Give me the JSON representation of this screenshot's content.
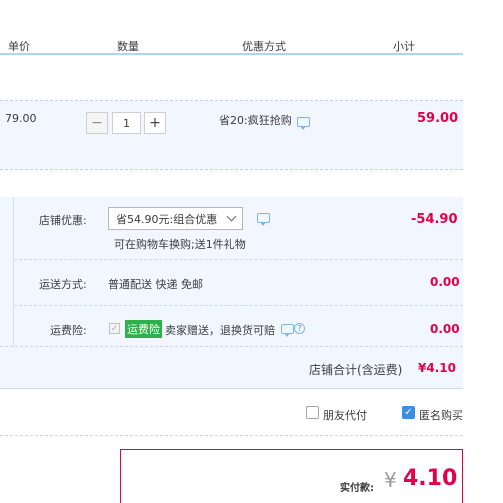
{
  "header": {
    "unit_price": "单价",
    "quantity": "数量",
    "discount_method": "优惠方式",
    "subtotal": "小计"
  },
  "item": {
    "unit_price": "79.00",
    "quantity": "1",
    "minus": "−",
    "plus": "+",
    "discount": "省20:疯狂抢购",
    "subtotal": "59.00"
  },
  "order": {
    "shop_discount_label": "店铺优惠:",
    "shop_discount_selected": "省54.90元:组合优惠",
    "shop_discount_note": "可在购物车换购;送1件礼物",
    "shop_discount_amount": "-54.90",
    "shipping_label": "运送方式:",
    "shipping_value": "普通配送 快递 免邮",
    "shipping_amount": "0.00",
    "insurance_label": "运费险:",
    "insurance_badge": "运费险",
    "insurance_text": "卖家赠送，退换货可赔",
    "insurance_amount": "0.00",
    "shop_total_label": "店铺合计(含运费)",
    "shop_total_amount": "¥4.10"
  },
  "options": {
    "friend_pay": "朋友代付",
    "anonymous_buy": "匿名购买"
  },
  "payment": {
    "label": "实付款:",
    "currency": "¥",
    "amount": "4.10"
  },
  "colors": {
    "accent_red": "#e4004a",
    "link_blue": "#3d8ee3",
    "badge_green": "#2eb14b"
  }
}
